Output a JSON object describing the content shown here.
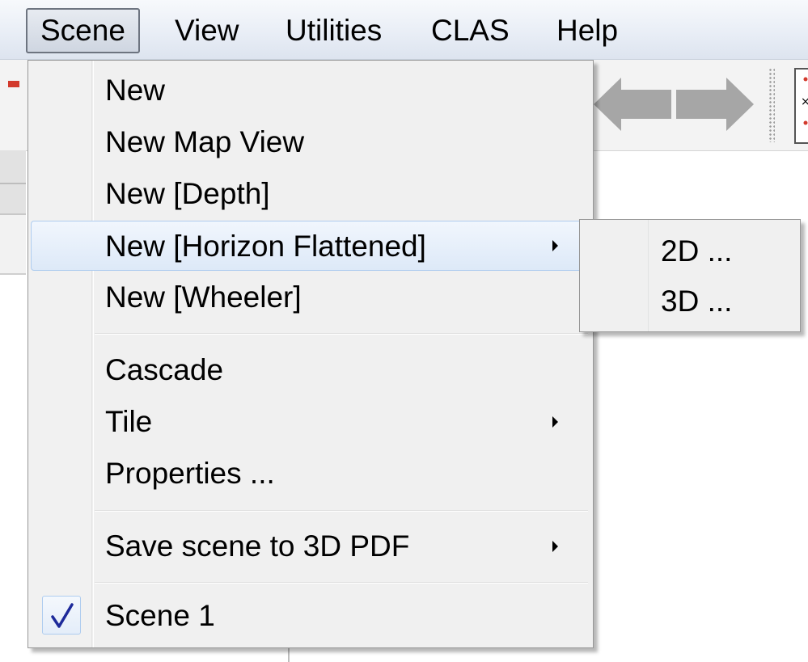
{
  "menubar": {
    "items": [
      {
        "label": "Scene",
        "active": true
      },
      {
        "label": "View"
      },
      {
        "label": "Utilities"
      },
      {
        "label": "CLAS"
      },
      {
        "label": "Help"
      }
    ]
  },
  "scene_menu": {
    "items": [
      {
        "label": "New"
      },
      {
        "label": "New Map View"
      },
      {
        "label": "New [Depth]"
      },
      {
        "label": "New [Horizon Flattened]",
        "has_submenu": true,
        "highlighted": true
      },
      {
        "label": "New [Wheeler]"
      },
      {
        "label": "Cascade"
      },
      {
        "label": "Tile",
        "has_submenu": true
      },
      {
        "label": "Properties ..."
      },
      {
        "label": "Save scene to 3D PDF",
        "has_submenu": true
      },
      {
        "label": "Scene 1",
        "checked": true
      }
    ]
  },
  "submenu": {
    "items": [
      {
        "label": "2D ..."
      },
      {
        "label": "3D ..."
      }
    ]
  },
  "icons": {
    "back": "arrow-left-icon",
    "forward": "arrow-right-icon",
    "check": "checkmark-icon",
    "submenu": "submenu-arrow-icon"
  },
  "colors": {
    "menu_bg": "#f0f0f0",
    "highlight_border": "#aeccef",
    "check_color": "#1e2a9a",
    "arrow_gray": "#a6a6a6"
  }
}
